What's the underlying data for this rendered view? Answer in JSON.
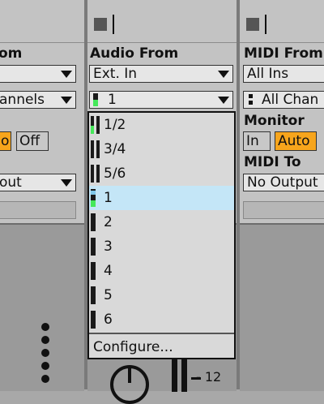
{
  "left_strip": {
    "heading_partial": "om",
    "channels_partial": "annels",
    "auto_partial": "o",
    "off_label": "Off",
    "output_partial": "out"
  },
  "middle_strip": {
    "audio_from_heading": "Audio From",
    "audio_from_value": "Ext. In",
    "channel_value": "1"
  },
  "right_strip": {
    "midi_from_heading": "MIDI From",
    "midi_from_value": "All Ins",
    "channel_value": "All Chan",
    "monitor_heading": "Monitor",
    "monitor_in": "In",
    "monitor_auto": "Auto",
    "midi_to_heading": "MIDI To",
    "midi_to_value": "No Output"
  },
  "dropdown": {
    "items": [
      {
        "label": "1/2",
        "meter": "stereo"
      },
      {
        "label": "3/4",
        "meter": "stereo"
      },
      {
        "label": "5/6",
        "meter": "stereo"
      },
      {
        "label": "1",
        "meter": "mono",
        "selected": true
      },
      {
        "label": "2",
        "meter": "mono"
      },
      {
        "label": "3",
        "meter": "mono"
      },
      {
        "label": "4",
        "meter": "mono"
      },
      {
        "label": "5",
        "meter": "mono"
      },
      {
        "label": "6",
        "meter": "mono"
      }
    ],
    "configure_label": "Configure..."
  },
  "bottom": {
    "volume_tick_label": "- 12"
  },
  "colors": {
    "accent_orange": "#f7a51c",
    "selection_blue": "#c4e6f7",
    "meter_green": "#45e85a"
  }
}
